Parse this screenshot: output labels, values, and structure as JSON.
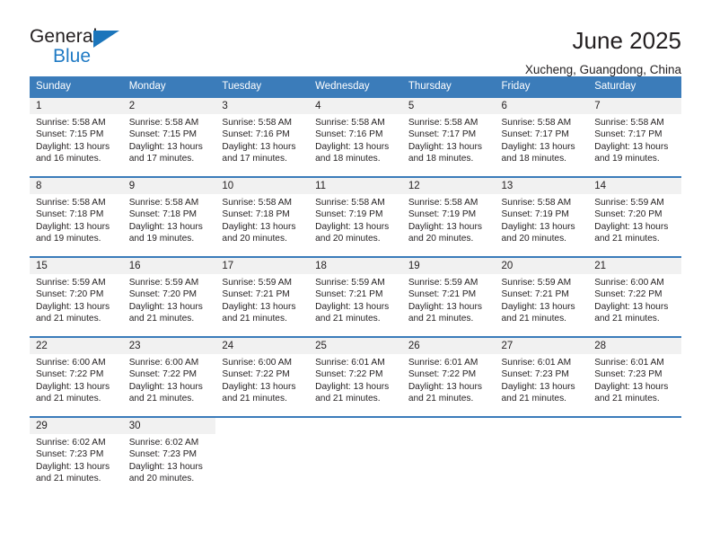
{
  "brand": {
    "name_top": "General",
    "name_bottom": "Blue",
    "triangle_color": "#1b75bb",
    "blue_color": "#1f7ac4"
  },
  "header": {
    "title": "June 2025",
    "location": "Xucheng, Guangdong, China"
  },
  "theme": {
    "header_blue": "#3b7cba",
    "daynum_bg": "#f1f1f1",
    "text": "#231f20"
  },
  "calendar": {
    "weekday_headers": [
      "Sunday",
      "Monday",
      "Tuesday",
      "Wednesday",
      "Thursday",
      "Friday",
      "Saturday"
    ],
    "weeks": [
      [
        {
          "day": "1",
          "sunrise": "Sunrise: 5:58 AM",
          "sunset": "Sunset: 7:15 PM",
          "daylight1": "Daylight: 13 hours",
          "daylight2": "and 16 minutes."
        },
        {
          "day": "2",
          "sunrise": "Sunrise: 5:58 AM",
          "sunset": "Sunset: 7:15 PM",
          "daylight1": "Daylight: 13 hours",
          "daylight2": "and 17 minutes."
        },
        {
          "day": "3",
          "sunrise": "Sunrise: 5:58 AM",
          "sunset": "Sunset: 7:16 PM",
          "daylight1": "Daylight: 13 hours",
          "daylight2": "and 17 minutes."
        },
        {
          "day": "4",
          "sunrise": "Sunrise: 5:58 AM",
          "sunset": "Sunset: 7:16 PM",
          "daylight1": "Daylight: 13 hours",
          "daylight2": "and 18 minutes."
        },
        {
          "day": "5",
          "sunrise": "Sunrise: 5:58 AM",
          "sunset": "Sunset: 7:17 PM",
          "daylight1": "Daylight: 13 hours",
          "daylight2": "and 18 minutes."
        },
        {
          "day": "6",
          "sunrise": "Sunrise: 5:58 AM",
          "sunset": "Sunset: 7:17 PM",
          "daylight1": "Daylight: 13 hours",
          "daylight2": "and 18 minutes."
        },
        {
          "day": "7",
          "sunrise": "Sunrise: 5:58 AM",
          "sunset": "Sunset: 7:17 PM",
          "daylight1": "Daylight: 13 hours",
          "daylight2": "and 19 minutes."
        }
      ],
      [
        {
          "day": "8",
          "sunrise": "Sunrise: 5:58 AM",
          "sunset": "Sunset: 7:18 PM",
          "daylight1": "Daylight: 13 hours",
          "daylight2": "and 19 minutes."
        },
        {
          "day": "9",
          "sunrise": "Sunrise: 5:58 AM",
          "sunset": "Sunset: 7:18 PM",
          "daylight1": "Daylight: 13 hours",
          "daylight2": "and 19 minutes."
        },
        {
          "day": "10",
          "sunrise": "Sunrise: 5:58 AM",
          "sunset": "Sunset: 7:18 PM",
          "daylight1": "Daylight: 13 hours",
          "daylight2": "and 20 minutes."
        },
        {
          "day": "11",
          "sunrise": "Sunrise: 5:58 AM",
          "sunset": "Sunset: 7:19 PM",
          "daylight1": "Daylight: 13 hours",
          "daylight2": "and 20 minutes."
        },
        {
          "day": "12",
          "sunrise": "Sunrise: 5:58 AM",
          "sunset": "Sunset: 7:19 PM",
          "daylight1": "Daylight: 13 hours",
          "daylight2": "and 20 minutes."
        },
        {
          "day": "13",
          "sunrise": "Sunrise: 5:58 AM",
          "sunset": "Sunset: 7:19 PM",
          "daylight1": "Daylight: 13 hours",
          "daylight2": "and 20 minutes."
        },
        {
          "day": "14",
          "sunrise": "Sunrise: 5:59 AM",
          "sunset": "Sunset: 7:20 PM",
          "daylight1": "Daylight: 13 hours",
          "daylight2": "and 21 minutes."
        }
      ],
      [
        {
          "day": "15",
          "sunrise": "Sunrise: 5:59 AM",
          "sunset": "Sunset: 7:20 PM",
          "daylight1": "Daylight: 13 hours",
          "daylight2": "and 21 minutes."
        },
        {
          "day": "16",
          "sunrise": "Sunrise: 5:59 AM",
          "sunset": "Sunset: 7:20 PM",
          "daylight1": "Daylight: 13 hours",
          "daylight2": "and 21 minutes."
        },
        {
          "day": "17",
          "sunrise": "Sunrise: 5:59 AM",
          "sunset": "Sunset: 7:21 PM",
          "daylight1": "Daylight: 13 hours",
          "daylight2": "and 21 minutes."
        },
        {
          "day": "18",
          "sunrise": "Sunrise: 5:59 AM",
          "sunset": "Sunset: 7:21 PM",
          "daylight1": "Daylight: 13 hours",
          "daylight2": "and 21 minutes."
        },
        {
          "day": "19",
          "sunrise": "Sunrise: 5:59 AM",
          "sunset": "Sunset: 7:21 PM",
          "daylight1": "Daylight: 13 hours",
          "daylight2": "and 21 minutes."
        },
        {
          "day": "20",
          "sunrise": "Sunrise: 5:59 AM",
          "sunset": "Sunset: 7:21 PM",
          "daylight1": "Daylight: 13 hours",
          "daylight2": "and 21 minutes."
        },
        {
          "day": "21",
          "sunrise": "Sunrise: 6:00 AM",
          "sunset": "Sunset: 7:22 PM",
          "daylight1": "Daylight: 13 hours",
          "daylight2": "and 21 minutes."
        }
      ],
      [
        {
          "day": "22",
          "sunrise": "Sunrise: 6:00 AM",
          "sunset": "Sunset: 7:22 PM",
          "daylight1": "Daylight: 13 hours",
          "daylight2": "and 21 minutes."
        },
        {
          "day": "23",
          "sunrise": "Sunrise: 6:00 AM",
          "sunset": "Sunset: 7:22 PM",
          "daylight1": "Daylight: 13 hours",
          "daylight2": "and 21 minutes."
        },
        {
          "day": "24",
          "sunrise": "Sunrise: 6:00 AM",
          "sunset": "Sunset: 7:22 PM",
          "daylight1": "Daylight: 13 hours",
          "daylight2": "and 21 minutes."
        },
        {
          "day": "25",
          "sunrise": "Sunrise: 6:01 AM",
          "sunset": "Sunset: 7:22 PM",
          "daylight1": "Daylight: 13 hours",
          "daylight2": "and 21 minutes."
        },
        {
          "day": "26",
          "sunrise": "Sunrise: 6:01 AM",
          "sunset": "Sunset: 7:22 PM",
          "daylight1": "Daylight: 13 hours",
          "daylight2": "and 21 minutes."
        },
        {
          "day": "27",
          "sunrise": "Sunrise: 6:01 AM",
          "sunset": "Sunset: 7:23 PM",
          "daylight1": "Daylight: 13 hours",
          "daylight2": "and 21 minutes."
        },
        {
          "day": "28",
          "sunrise": "Sunrise: 6:01 AM",
          "sunset": "Sunset: 7:23 PM",
          "daylight1": "Daylight: 13 hours",
          "daylight2": "and 21 minutes."
        }
      ],
      [
        {
          "day": "29",
          "sunrise": "Sunrise: 6:02 AM",
          "sunset": "Sunset: 7:23 PM",
          "daylight1": "Daylight: 13 hours",
          "daylight2": "and 21 minutes."
        },
        {
          "day": "30",
          "sunrise": "Sunrise: 6:02 AM",
          "sunset": "Sunset: 7:23 PM",
          "daylight1": "Daylight: 13 hours",
          "daylight2": "and 20 minutes."
        },
        {
          "day": "",
          "sunrise": "",
          "sunset": "",
          "daylight1": "",
          "daylight2": ""
        },
        {
          "day": "",
          "sunrise": "",
          "sunset": "",
          "daylight1": "",
          "daylight2": ""
        },
        {
          "day": "",
          "sunrise": "",
          "sunset": "",
          "daylight1": "",
          "daylight2": ""
        },
        {
          "day": "",
          "sunrise": "",
          "sunset": "",
          "daylight1": "",
          "daylight2": ""
        },
        {
          "day": "",
          "sunrise": "",
          "sunset": "",
          "daylight1": "",
          "daylight2": ""
        }
      ]
    ]
  }
}
